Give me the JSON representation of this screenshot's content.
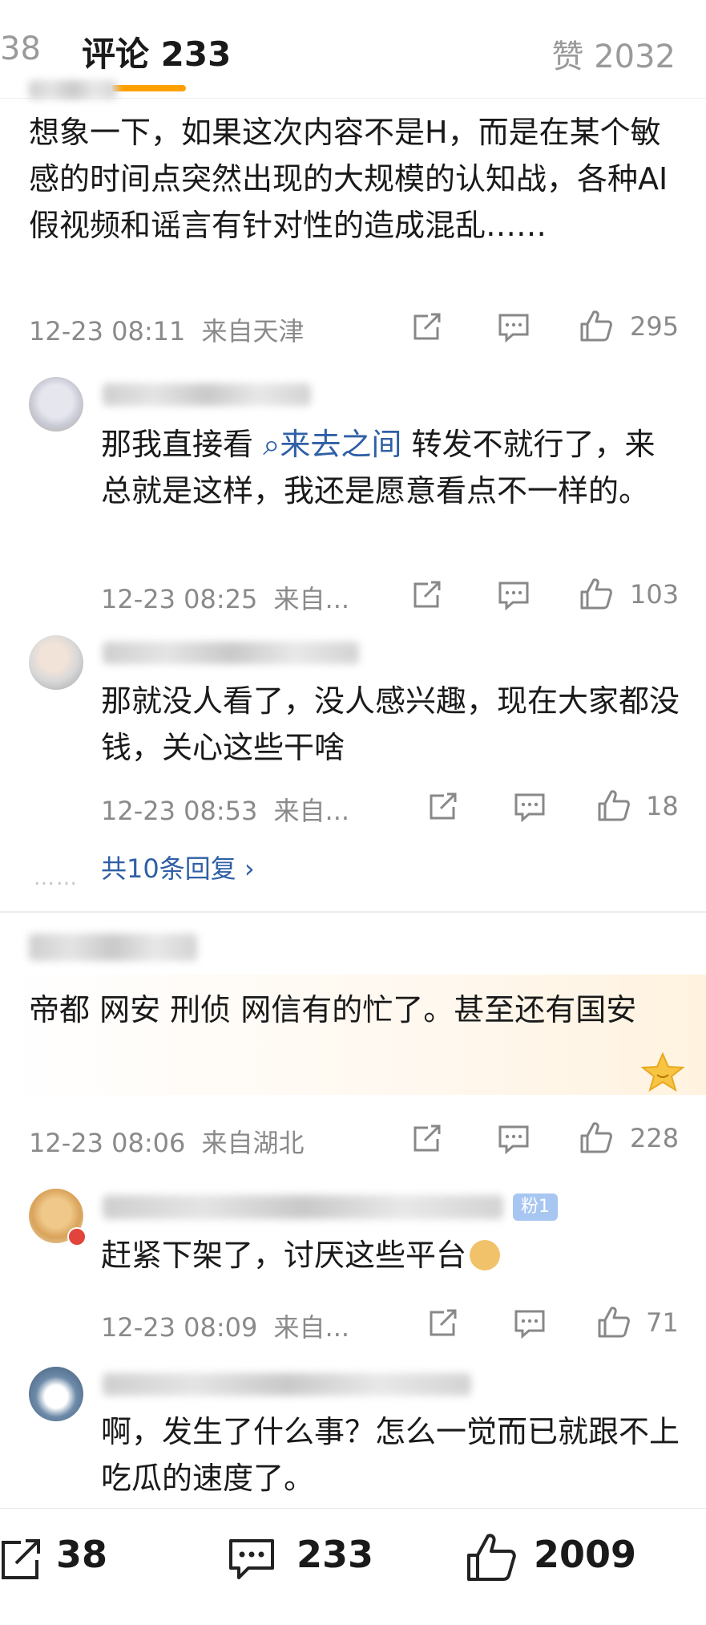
{
  "header": {
    "tab_repost": "38",
    "tab_comment": "评论 233",
    "tab_like": "赞 2032"
  },
  "comments": [
    {
      "text": "想象一下，如果这次内容不是H，而是在某个敏感的时间点突然出现的大规模的认知战，各种AI假视频和谣言有针对性的造成混乱……",
      "time": "12-23 08:11",
      "location": "来自天津",
      "likes": "295",
      "replies": [
        {
          "text_before": "那我直接看",
          "topic": "来去之间",
          "text_after": " 转发不就行了，来总就是这样，我还是愿意看点不一样的。",
          "time": "12-23 08:25",
          "location": "来自...",
          "likes": "103"
        },
        {
          "text": "那就没人看了，没人感兴趣，现在大家都没钱，关心这些干啥",
          "time": "12-23 08:53",
          "location": "来自...",
          "likes": "18"
        }
      ],
      "more_replies": "共10条回复"
    },
    {
      "text": "帝都 网安 刑侦 网信有的忙了。甚至还有国安",
      "time": "12-23 08:06",
      "location": "来自湖北",
      "likes": "228",
      "replies": [
        {
          "badge": "粉1",
          "text": "赶紧下架了，讨厌这些平台",
          "time": "12-23 08:09",
          "location": "来自...",
          "likes": "71"
        },
        {
          "text": "啊，发生了什么事？怎么一觉而已就跟不上吃瓜的速度了。"
        }
      ]
    }
  ],
  "bottom_bar": {
    "reposts": "38",
    "comments": "233",
    "likes": "2009"
  },
  "colors": {
    "accent": "#ffa000",
    "link": "#2f5fa6",
    "meta": "#8a8a8a"
  }
}
